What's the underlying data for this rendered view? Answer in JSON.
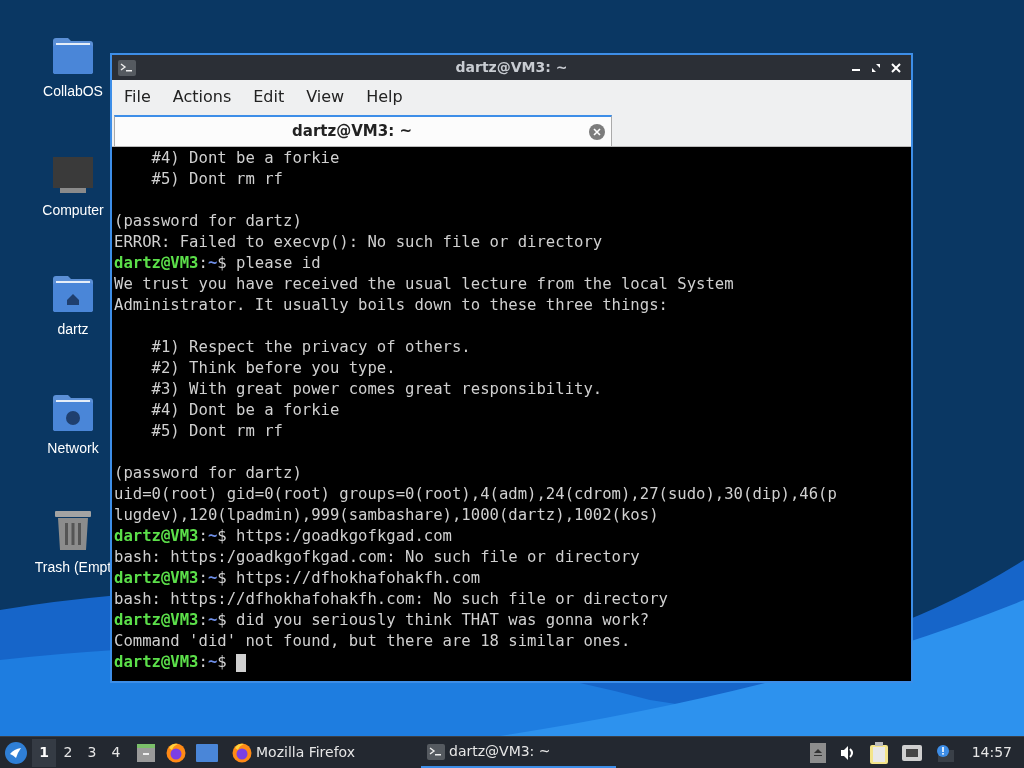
{
  "desktop_icons": [
    {
      "kind": "folder",
      "label": "CollabOS"
    },
    {
      "kind": "computer",
      "label": "Computer"
    },
    {
      "kind": "home",
      "label": "dartz"
    },
    {
      "kind": "network",
      "label": "Network"
    },
    {
      "kind": "trash",
      "label": "Trash (Empt"
    }
  ],
  "window": {
    "title": "dartz@VM3: ~",
    "menu": [
      "File",
      "Actions",
      "Edit",
      "View",
      "Help"
    ],
    "tabs": [
      {
        "label": "dartz@VM3: ~",
        "selected": true
      }
    ],
    "lines": [
      {
        "kind": "text",
        "text": "    #4) Dont be a forkie"
      },
      {
        "kind": "text",
        "text": "    #5) Dont rm rf"
      },
      {
        "kind": "blank"
      },
      {
        "kind": "text",
        "text": "(password for dartz)"
      },
      {
        "kind": "text",
        "text": "ERROR: Failed to execvp(): No such file or directory"
      },
      {
        "kind": "prompt",
        "user": "dartz@VM3",
        "sep": ":",
        "path": "~",
        "sign": "$",
        "command": " please id"
      },
      {
        "kind": "text",
        "text": "We trust you have received the usual lecture from the local System"
      },
      {
        "kind": "text",
        "text": "Administrator. It usually boils down to these three things:"
      },
      {
        "kind": "blank"
      },
      {
        "kind": "text",
        "text": "    #1) Respect the privacy of others."
      },
      {
        "kind": "text",
        "text": "    #2) Think before you type."
      },
      {
        "kind": "text",
        "text": "    #3) With great power comes great responsibility."
      },
      {
        "kind": "text",
        "text": "    #4) Dont be a forkie"
      },
      {
        "kind": "text",
        "text": "    #5) Dont rm rf"
      },
      {
        "kind": "blank"
      },
      {
        "kind": "text",
        "text": "(password for dartz)"
      },
      {
        "kind": "text",
        "text": "uid=0(root) gid=0(root) groups=0(root),4(adm),24(cdrom),27(sudo),30(dip),46(p"
      },
      {
        "kind": "text",
        "text": "lugdev),120(lpadmin),999(sambashare),1000(dartz),1002(kos)"
      },
      {
        "kind": "prompt",
        "user": "dartz@VM3",
        "sep": ":",
        "path": "~",
        "sign": "$",
        "command": " https:/goadkgofkgad.com"
      },
      {
        "kind": "text",
        "text": "bash: https:/goadkgofkgad.com: No such file or directory"
      },
      {
        "kind": "prompt",
        "user": "dartz@VM3",
        "sep": ":",
        "path": "~",
        "sign": "$",
        "command": " https://dfhokhafohakfh.com"
      },
      {
        "kind": "text",
        "text": "bash: https://dfhokhafohakfh.com: No such file or directory"
      },
      {
        "kind": "prompt",
        "user": "dartz@VM3",
        "sep": ":",
        "path": "~",
        "sign": "$",
        "command": " did you seriously think THAT was gonna work?"
      },
      {
        "kind": "text",
        "text": "Command 'did' not found, but there are 18 similar ones."
      },
      {
        "kind": "prompt",
        "user": "dartz@VM3",
        "sep": ":",
        "path": "~",
        "sign": "$",
        "cursor": true
      }
    ]
  },
  "taskbar": {
    "workspaces": [
      {
        "label": "1",
        "selected": true
      },
      {
        "label": "2",
        "selected": false
      },
      {
        "label": "3",
        "selected": false
      },
      {
        "label": "4",
        "selected": false
      }
    ],
    "launchers": [
      {
        "kind": "files"
      },
      {
        "kind": "firefox"
      },
      {
        "kind": "desktop"
      }
    ],
    "tasks": [
      {
        "kind": "firefox",
        "label": "Mozilla Firefox",
        "selected": false
      },
      {
        "kind": "terminal",
        "label": "dartz@VM3: ~",
        "selected": true
      }
    ],
    "tray": [
      {
        "kind": "eject"
      },
      {
        "kind": "volume"
      },
      {
        "kind": "clipboard"
      },
      {
        "kind": "network"
      },
      {
        "kind": "notification"
      }
    ],
    "clock": "14:57"
  }
}
